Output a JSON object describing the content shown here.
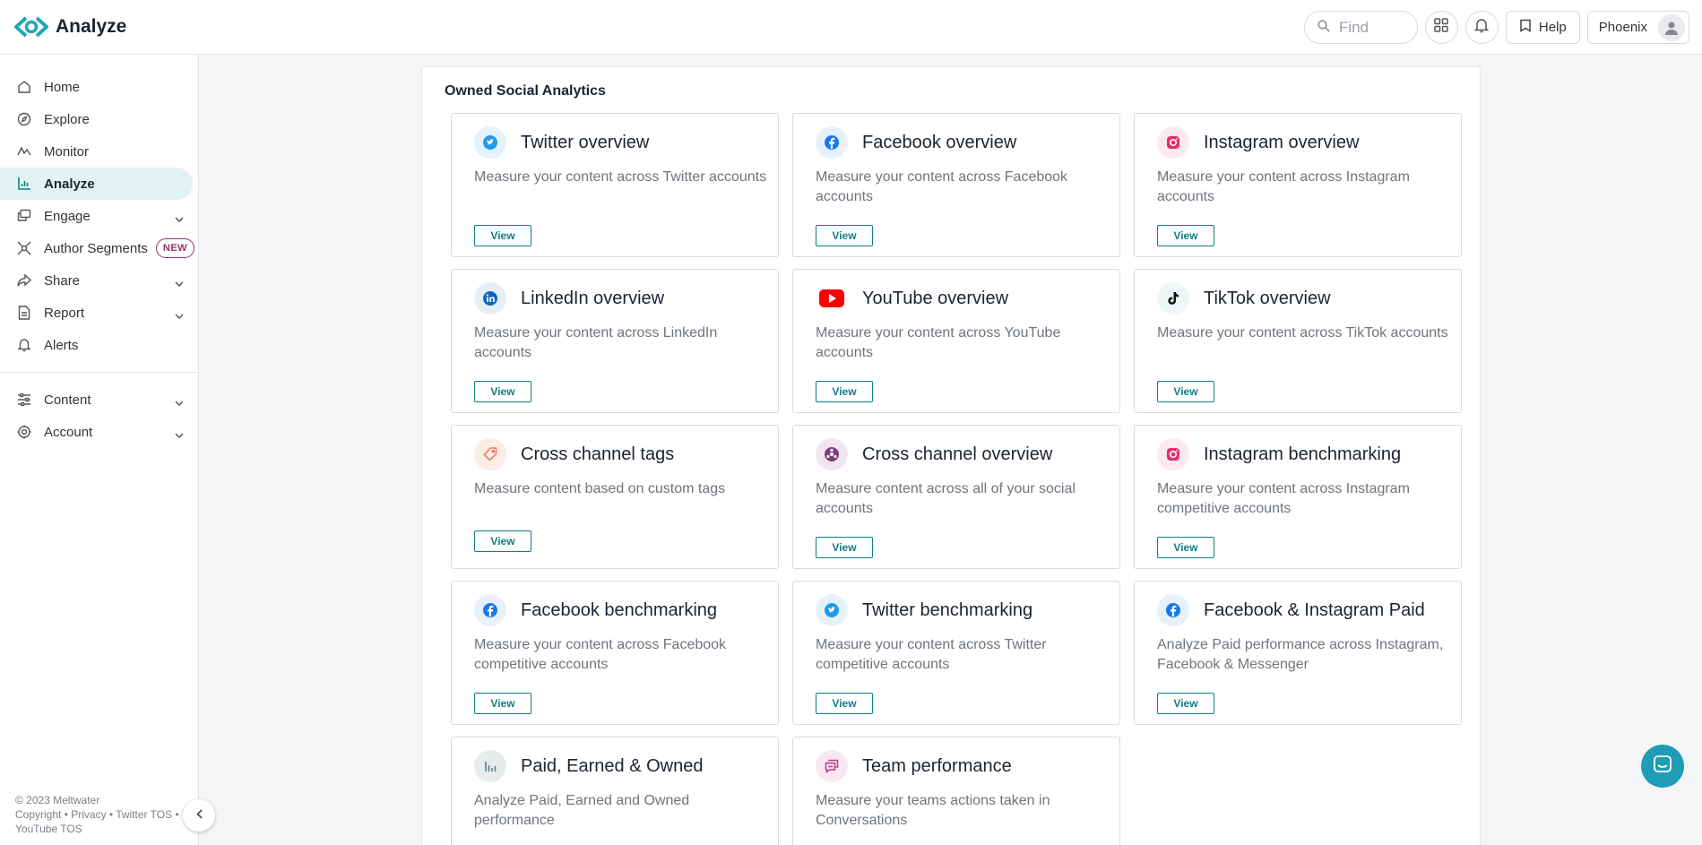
{
  "app": {
    "title": "Analyze"
  },
  "topbar": {
    "search_placeholder": "Find",
    "help_label": "Help",
    "user_name": "Phoenix"
  },
  "sidebar": {
    "items": [
      {
        "label": "Home",
        "icon": "home-icon"
      },
      {
        "label": "Explore",
        "icon": "compass-icon"
      },
      {
        "label": "Monitor",
        "icon": "monitor-icon"
      },
      {
        "label": "Analyze",
        "icon": "bar-chart-icon",
        "active": true
      },
      {
        "label": "Engage",
        "icon": "engage-icon",
        "expandable": true
      },
      {
        "label": "Author Segments",
        "icon": "segments-icon",
        "badge": "NEW"
      },
      {
        "label": "Share",
        "icon": "share-icon",
        "expandable": true
      },
      {
        "label": "Report",
        "icon": "report-icon",
        "expandable": true
      },
      {
        "label": "Alerts",
        "icon": "bell-icon"
      }
    ],
    "secondary": [
      {
        "label": "Content",
        "icon": "sliders-icon",
        "expandable": true
      },
      {
        "label": "Account",
        "icon": "gear-icon",
        "expandable": true
      }
    ],
    "footer_line1": "© 2023 Meltwater",
    "footer_line2": "Copyright • Privacy • Twitter TOS •",
    "footer_line3": "YouTube TOS"
  },
  "main": {
    "section_title": "Owned Social Analytics",
    "view_label": "View",
    "cards": [
      {
        "title": "Twitter overview",
        "desc": "Measure your content across Twitter accounts",
        "icon": "twitter-icon"
      },
      {
        "title": "Facebook overview",
        "desc": "Measure your content across Facebook accounts",
        "icon": "facebook-icon"
      },
      {
        "title": "Instagram overview",
        "desc": "Measure your content across Instagram accounts",
        "icon": "instagram-icon"
      },
      {
        "title": "LinkedIn overview",
        "desc": "Measure your content across LinkedIn accounts",
        "icon": "linkedin-icon"
      },
      {
        "title": "YouTube overview",
        "desc": "Measure your content across YouTube accounts",
        "icon": "youtube-icon"
      },
      {
        "title": "TikTok overview",
        "desc": "Measure your content across TikTok accounts",
        "icon": "tiktok-icon"
      },
      {
        "title": "Cross channel tags",
        "desc": "Measure content based on custom tags",
        "icon": "tag-icon"
      },
      {
        "title": "Cross channel overview",
        "desc": "Measure content across all of your social accounts",
        "icon": "cross-channel-icon"
      },
      {
        "title": "Instagram benchmarking",
        "desc": "Measure your content across Instagram competitive accounts",
        "icon": "instagram-icon"
      },
      {
        "title": "Facebook benchmarking",
        "desc": "Measure your content across Facebook competitive accounts",
        "icon": "facebook-icon"
      },
      {
        "title": "Twitter benchmarking",
        "desc": "Measure your content across Twitter competitive accounts",
        "icon": "twitter-icon"
      },
      {
        "title": "Facebook & Instagram Paid",
        "desc": "Analyze Paid performance across Instagram, Facebook & Messenger",
        "icon": "facebook-icon"
      },
      {
        "title": "Paid, Earned & Owned",
        "desc": "Analyze Paid, Earned and Owned performance",
        "icon": "bar-chart-icon"
      },
      {
        "title": "Team performance",
        "desc": "Measure your teams actions taken in Conversations",
        "icon": "chat-icon"
      }
    ]
  },
  "colors": {
    "accent": "#0f7e84",
    "active_bg": "#e2f3f3",
    "badge": "#9b2c6b",
    "twitter": "#1d9bf0",
    "facebook": "#1877f2",
    "instagram": "#e1306c",
    "youtube": "#ff0000"
  }
}
